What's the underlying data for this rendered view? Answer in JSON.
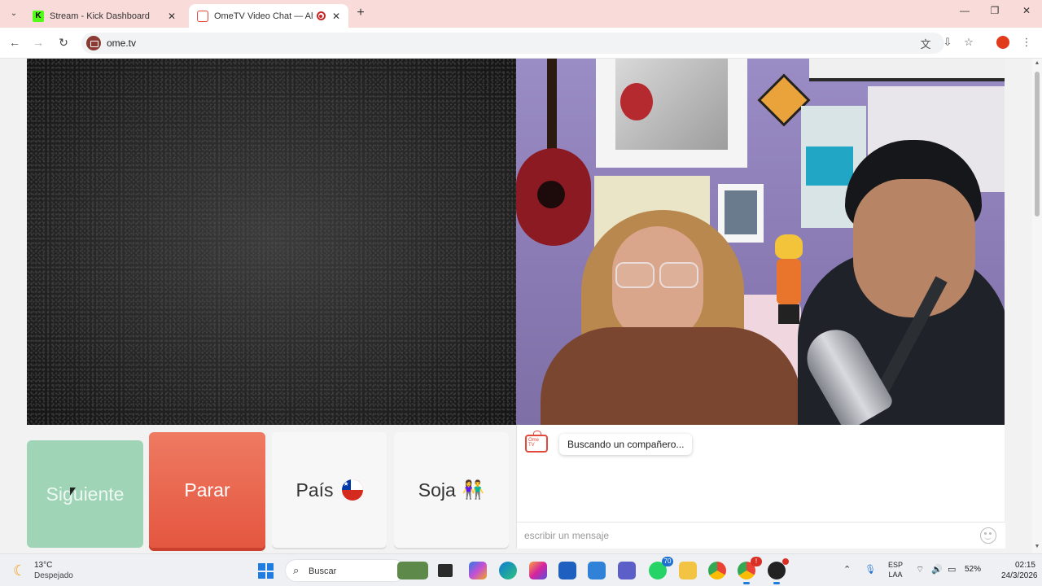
{
  "browser": {
    "tabs": [
      {
        "title": "Stream - Kick Dashboard",
        "favicon": "kick-icon"
      },
      {
        "title": "OmeTV Video Chat — Alte",
        "favicon": "ometv-icon",
        "recording": true
      }
    ],
    "url": "ome.tv",
    "profile_color": "#e23b1c"
  },
  "video": {
    "self_state": "static-noise",
    "remote_state": "connected-feed"
  },
  "controls": {
    "next_label": "Siguiente",
    "stop_label": "Parar",
    "country_label": "País",
    "country_flag": "chile-flag-icon",
    "gender_label": "Soja",
    "gender_icon": "couple-icon"
  },
  "chat": {
    "logo_text": "Ome TV",
    "status_message": "Buscando un compañero...",
    "input_placeholder": "escribir un mensaje"
  },
  "colors": {
    "next_button": "#9fd4b6",
    "stop_button": "#e4563f",
    "accent": "#e3493b",
    "tabstrip": "#f9dcd9"
  },
  "taskbar": {
    "temperature": "13°C",
    "weather_condition": "Despejado",
    "search_label": "Buscar",
    "teams_badge": "70",
    "language_line1": "ESP",
    "language_line2": "LAA",
    "battery": "52%",
    "time": "02:15",
    "date": "24/3/2026"
  }
}
